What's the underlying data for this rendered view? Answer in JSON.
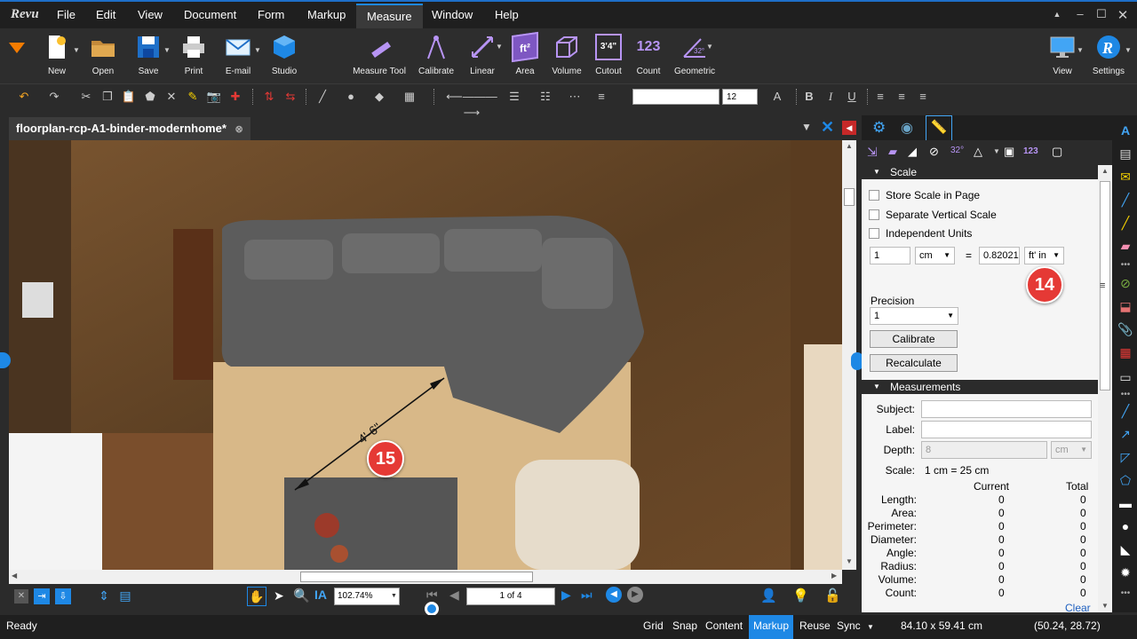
{
  "menu": {
    "logo": "Revu",
    "items": [
      "File",
      "Edit",
      "View",
      "Document",
      "Form",
      "Markup",
      "Measure",
      "Window",
      "Help"
    ],
    "active": "Measure"
  },
  "ribbon": {
    "left": [
      {
        "label": "New",
        "icon": "new-document-icon"
      },
      {
        "label": "Open",
        "icon": "folder-icon"
      },
      {
        "label": "Save",
        "icon": "save-icon"
      },
      {
        "label": "Print",
        "icon": "printer-icon"
      },
      {
        "label": "E-mail",
        "icon": "email-icon"
      },
      {
        "label": "Studio",
        "icon": "studio-cube-icon"
      }
    ],
    "measure": [
      {
        "label": "Measure Tool",
        "icon": "ruler-icon",
        "glyph": "📏"
      },
      {
        "label": "Calibrate",
        "icon": "calibrate-icon",
        "glyph": "⟋"
      },
      {
        "label": "Linear",
        "icon": "linear-icon",
        "glyph": "⇲"
      },
      {
        "label": "Area",
        "icon": "area-icon",
        "glyph": "ft²"
      },
      {
        "label": "Volume",
        "icon": "volume-icon",
        "glyph": "▣"
      },
      {
        "label": "Cutout",
        "icon": "cutout-icon",
        "glyph": "3'4\""
      },
      {
        "label": "Count",
        "icon": "count-icon",
        "glyph": "123"
      },
      {
        "label": "Geometric",
        "icon": "geometric-icon",
        "glyph": "32°"
      }
    ],
    "right": [
      {
        "label": "View",
        "icon": "monitor-icon"
      },
      {
        "label": "Settings",
        "icon": "revu-settings-icon"
      }
    ]
  },
  "toolbar": {
    "font_size": "12"
  },
  "document": {
    "tab_title": "floorplan-rcp-A1-binder-modernhome*",
    "dimension_label": "4'-6\""
  },
  "badges": {
    "b14": "14",
    "b15": "15"
  },
  "navigation": {
    "zoom": "102.74%",
    "page": "1 of 4"
  },
  "status": {
    "ready": "Ready",
    "items": [
      "Grid",
      "Snap",
      "Content",
      "Markup",
      "Reuse",
      "Sync"
    ],
    "active": "Markup",
    "page_size": "84.10 x 59.41 cm",
    "coords": "(50.24, 28.72)"
  },
  "panel": {
    "scale_section": "Scale",
    "store_scale": "Store Scale in Page",
    "separate_vertical": "Separate Vertical Scale",
    "independent_units": "Independent Units",
    "scale_value_left": "1",
    "scale_unit_left": "cm",
    "equals": "=",
    "scale_value_right": "0.82021",
    "scale_unit_right": "ft' in",
    "precision_label": "Precision",
    "precision_value": "1",
    "calibrate_btn": "Calibrate",
    "recalculate_btn": "Recalculate",
    "measurements_section": "Measurements",
    "subject_label": "Subject:",
    "label_label": "Label:",
    "depth_label": "Depth:",
    "depth_value": "8",
    "depth_unit": "cm",
    "scale_label": "Scale:",
    "scale_text": "1 cm = 25 cm",
    "col_current": "Current",
    "col_total": "Total",
    "rows": [
      {
        "name": "Length:",
        "current": "0",
        "total": "0"
      },
      {
        "name": "Area:",
        "current": "0",
        "total": "0"
      },
      {
        "name": "Perimeter:",
        "current": "0",
        "total": "0"
      },
      {
        "name": "Diameter:",
        "current": "0",
        "total": "0"
      },
      {
        "name": "Angle:",
        "current": "0",
        "total": "0"
      },
      {
        "name": "Radius:",
        "current": "0",
        "total": "0"
      },
      {
        "name": "Volume:",
        "current": "0",
        "total": "0"
      },
      {
        "name": "Count:",
        "current": "0",
        "total": "0"
      }
    ],
    "clear_link": "Clear"
  },
  "colors": {
    "accent": "#1e88e5",
    "badge": "#e53935",
    "ribbon_purple": "#9b6cd6"
  }
}
